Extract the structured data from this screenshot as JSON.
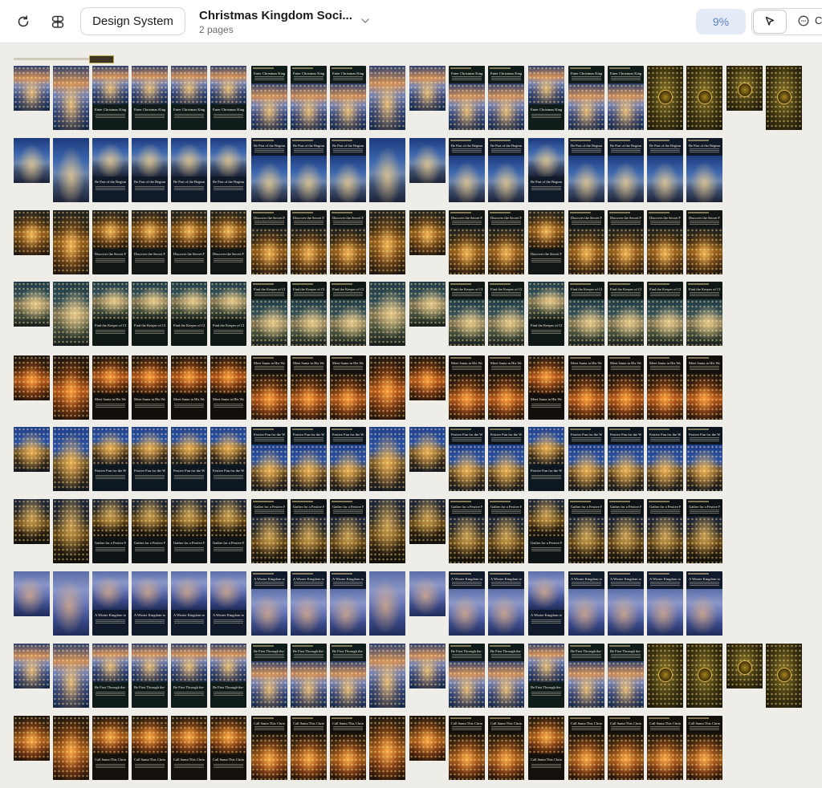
{
  "toolbar": {
    "refresh_icon": "refresh-icon",
    "pages_icon": "pages-icon",
    "design_system_label": "Design System",
    "document_title": "Christmas Kingdom Soci...",
    "document_subtitle": "2 pages",
    "zoom_label": "9%",
    "pointer_icon": "pointer-icon",
    "comment_icon": "comment-icon",
    "comment_label": "C"
  },
  "canvas": {
    "rows": [
      {
        "name": "Enter Christmas Kingdom",
        "theme": "dusk-village",
        "count": 20
      },
      {
        "name": "Be Part of the Beginning",
        "theme": "blue-castle",
        "count": 18
      },
      {
        "name": "Discover the Secret Forest",
        "theme": "gold-forest",
        "count": 18
      },
      {
        "name": "Find the Keeper of Christmas",
        "theme": "dragon-forest",
        "count": 18
      },
      {
        "name": "Meet Santa in His Woodland Grotto",
        "theme": "fire-grotto",
        "count": 18
      },
      {
        "name": "Festive Fun for the Whole Family",
        "theme": "night-house",
        "count": 18
      },
      {
        "name": "Gather for a Festive Feast",
        "theme": "feast-lights",
        "count": 18
      },
      {
        "name": "A Winter Kingdom to Discover",
        "theme": "snow-village",
        "count": 18
      },
      {
        "name": "Be First Through the Gates",
        "theme": "dusk-village",
        "count": 20
      },
      {
        "name": "Call Santa This Christmas",
        "theme": "santa-grotto",
        "count": 18
      }
    ]
  }
}
